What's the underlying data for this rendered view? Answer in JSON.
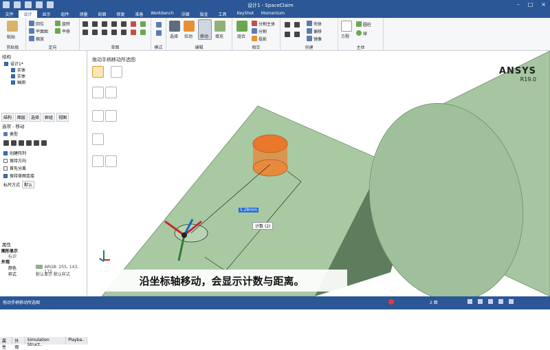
{
  "titlebar": {
    "title": "设计1 - SpaceClaim"
  },
  "menu": [
    "文件",
    "设计",
    "显示",
    "组件",
    "测量",
    "刻面",
    "修复",
    "准备",
    "Workbench",
    "详细",
    "钣金",
    "工具",
    "KeyShot",
    "Momentum"
  ],
  "ribbon": {
    "groups": {
      "clipboard": "剪贴板",
      "orient": "定向",
      "sketch": "草图",
      "mode": "模式",
      "edit": "编辑",
      "intersect": "相交",
      "create": "创建",
      "body": "主体"
    },
    "clipboard_paste": "粘贴",
    "orient_items": [
      "回位",
      "平面图",
      "缩放",
      "旋转",
      "平移"
    ],
    "mode_items": [
      "选择",
      "拉动",
      "移动",
      "填充"
    ],
    "intersect_items": [
      "组合",
      "分割主体",
      "分割",
      "投影"
    ],
    "create_items": [
      "壳体",
      "偏移",
      "镜像"
    ],
    "body_items": [
      "方程",
      "圆柱",
      "球"
    ]
  },
  "structure": {
    "title": "结构",
    "tree": [
      {
        "label": "设计1*",
        "level": 0
      },
      {
        "label": "实体",
        "level": 1
      },
      {
        "label": "实体",
        "level": 1
      },
      {
        "label": "轴测",
        "level": 1
      }
    ]
  },
  "panel_tabs": [
    "结构",
    "图层",
    "选择",
    "群组",
    "视图"
  ],
  "options": {
    "title": "选项 - 移动",
    "section": "类型",
    "checks": [
      {
        "label": "创建阵列",
        "on": true
      },
      {
        "label": "保持方向",
        "on": false
      },
      {
        "label": "首先分离",
        "on": false
      },
      {
        "label": "保持草图连接",
        "on": true
      }
    ],
    "ruler_label": "标尺方式",
    "ruler_value": "默认"
  },
  "properties": {
    "title": "属性",
    "group1": "图形显示",
    "group1_sub": "标识",
    "group2": "外观",
    "rows": [
      {
        "key": "颜色",
        "value": "ARGB: 255, 143, 175"
      },
      {
        "key": "样式",
        "value": "默认显示  默认样式"
      }
    ]
  },
  "bottom_tabs": [
    "属性",
    "外观",
    "Simulation Struct..",
    "Playba.."
  ],
  "viewport": {
    "hint": "拖动手柄移动所选图",
    "brand": "ANSYS",
    "version": "R19.0",
    "dimension": "5.28mm",
    "count_label": "计数 (2)",
    "caption": "沿坐标轴移动，会显示计数与距离。"
  },
  "status": {
    "text": "拖动手柄移动所选图",
    "right": "2 面"
  },
  "colors": {
    "accent": "#2b5797",
    "model_green": "#a9c9a3",
    "cylinder_orange": "#e68a3c"
  }
}
